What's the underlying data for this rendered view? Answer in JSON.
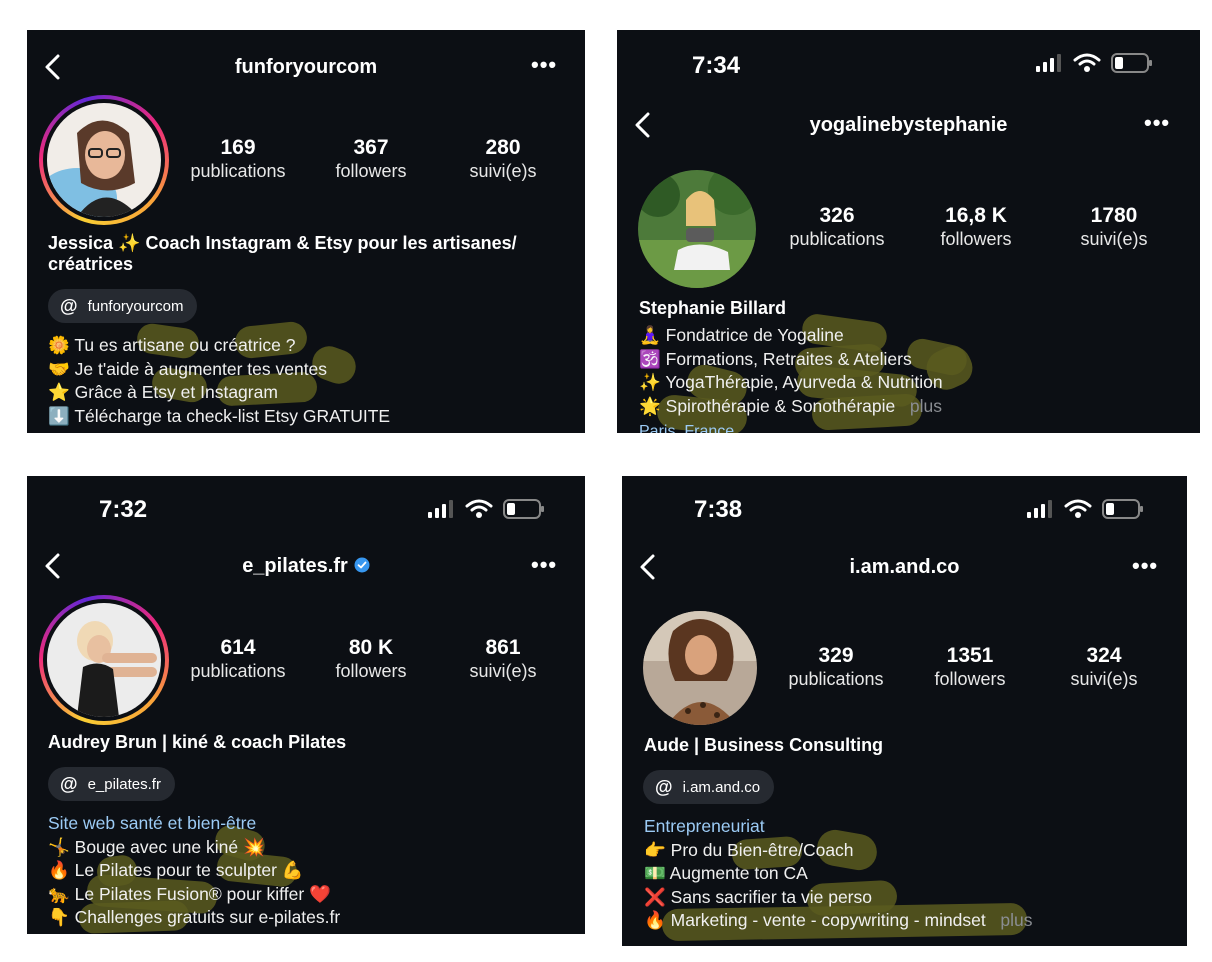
{
  "profiles": [
    {
      "time": "",
      "username": "funforyourcom",
      "stats": [
        {
          "num": "169",
          "label": "publications"
        },
        {
          "num": "367",
          "label": "followers"
        },
        {
          "num": "280",
          "label": "suivi(e)s"
        }
      ],
      "name_line1": "Jessica ✨ Coach Instagram & Etsy pour les artisanes/",
      "name_line2": "créatrices",
      "threads": "funforyourcom",
      "bio": [
        "🌼 Tu es artisane ou créatrice ?",
        "🤝 Je t'aide à augmenter tes ventes",
        "⭐ Grâce à Etsy et Instagram",
        "⬇️ Télécharge ta check-list Etsy GRATUITE"
      ]
    },
    {
      "time": "7:34",
      "username": "yogalinebystephanie",
      "stats": [
        {
          "num": "326",
          "label": "publications"
        },
        {
          "num": "16,8 K",
          "label": "followers"
        },
        {
          "num": "1780",
          "label": "suivi(e)s"
        }
      ],
      "name_line1": "Stephanie Billard",
      "bio": [
        "🧘‍♀️ Fondatrice de Yogaline",
        "🕉️ Formations, Retraites & Ateliers",
        "✨ YogaThérapie, Ayurveda & Nutrition",
        "🌟 Spirothérapie & Sonothérapie"
      ],
      "more": "plus",
      "location_cut": "Paris, France"
    },
    {
      "time": "7:32",
      "username": "e_pilates.fr",
      "stats": [
        {
          "num": "614",
          "label": "publications"
        },
        {
          "num": "80 K",
          "label": "followers"
        },
        {
          "num": "861",
          "label": "suivi(e)s"
        }
      ],
      "name_line1": "Audrey Brun | kiné & coach Pilates",
      "threads": "e_pilates.fr",
      "link": "Site web santé et bien-être",
      "bio": [
        "🤸 Bouge avec une kiné 💥",
        "🔥 Le Pilates pour te sculpter 💪",
        "🐆 Le Pilates Fusion® pour kiffer ❤️",
        "👇 Challenges gratuits sur e-pilates.fr"
      ]
    },
    {
      "time": "7:38",
      "username": "i.am.and.co",
      "stats": [
        {
          "num": "329",
          "label": "publications"
        },
        {
          "num": "1351",
          "label": "followers"
        },
        {
          "num": "324",
          "label": "suivi(e)s"
        }
      ],
      "name_line1": "Aude | Business Consulting",
      "threads": "i.am.and.co",
      "link": "Entrepreneuriat",
      "bio": [
        "👉 Pro du Bien-être/Coach",
        "💵 Augmente ton CA",
        "❌ Sans sacrifier ta vie perso",
        "🔥 Marketing - vente - copywriting - mindset"
      ],
      "more": "plus"
    }
  ],
  "colors": {
    "panel_bg": "#0c0f14",
    "link": "#9ccbf5",
    "highlight": "#5b5a1f",
    "pill": "#262a31",
    "verified": "#3797f0"
  }
}
